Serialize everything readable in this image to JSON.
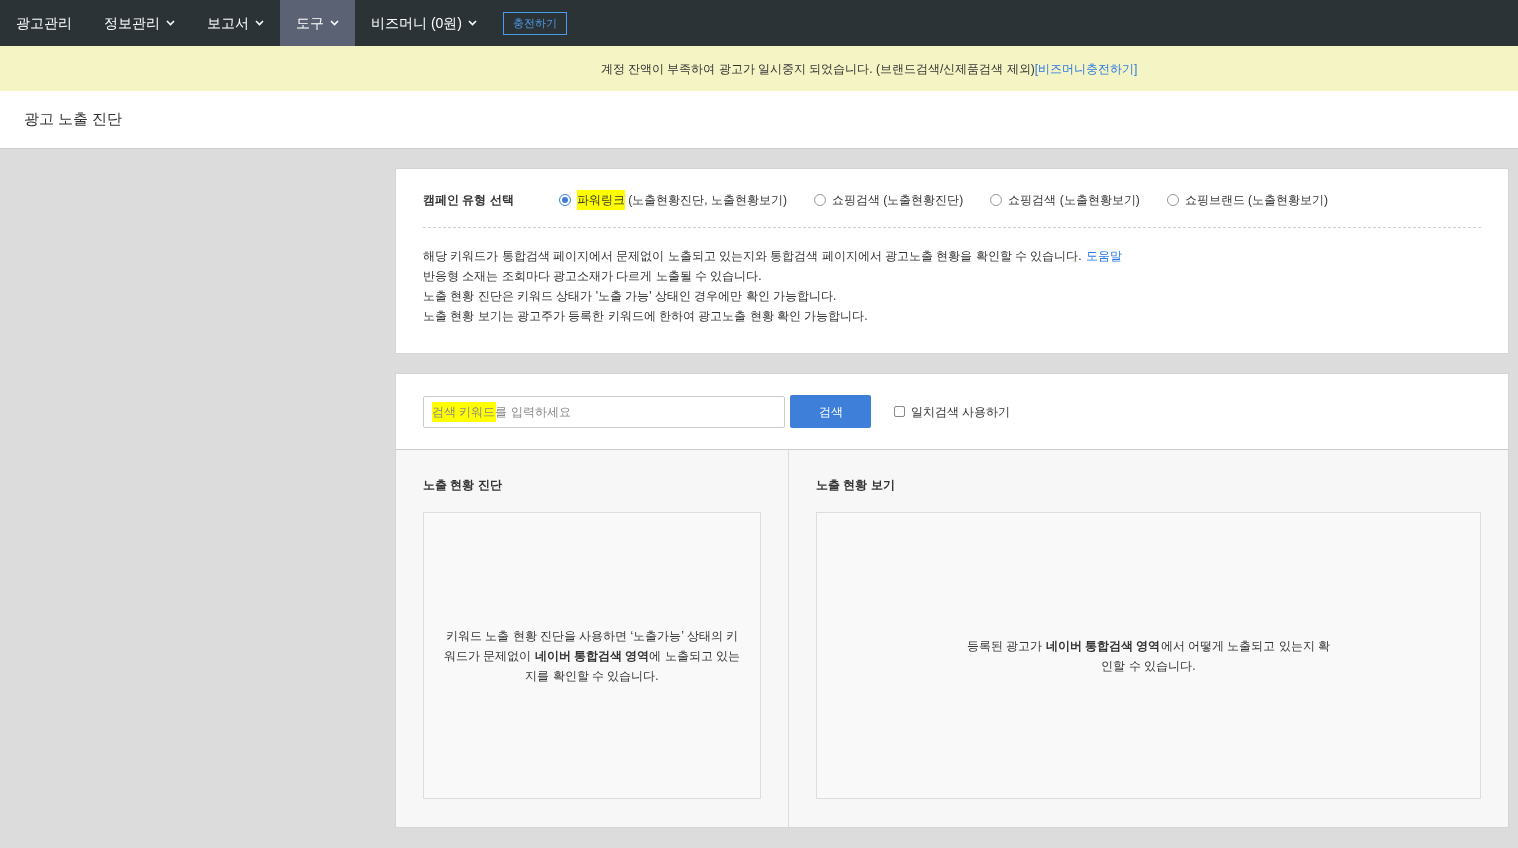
{
  "nav": {
    "items": [
      {
        "label": "광고관리",
        "dropdown": false,
        "selected": false
      },
      {
        "label": "정보관리",
        "dropdown": true,
        "selected": false
      },
      {
        "label": "보고서",
        "dropdown": true,
        "selected": false
      },
      {
        "label": "도구",
        "dropdown": true,
        "selected": true
      },
      {
        "label": "비즈머니 (0원)",
        "dropdown": true,
        "selected": false
      }
    ],
    "charge_button": "충전하기"
  },
  "notice": {
    "text": "계정 잔액이 부족하여 광고가 일시중지 되었습니다. (브랜드검색/신제품검색 제외)",
    "link": "[비즈머니충전하기]"
  },
  "page_title": "광고 노출 진단",
  "campaign_type": {
    "label": "캠페인 유형 선택",
    "options": [
      {
        "name": "파워링크",
        "detail": "(노출현황진단, 노출현황보기)",
        "selected": true,
        "highlighted": true
      },
      {
        "name": "쇼핑검색",
        "detail": "(노출현황진단)",
        "selected": false,
        "highlighted": false
      },
      {
        "name": "쇼핑검색",
        "detail": "(노출현황보기)",
        "selected": false,
        "highlighted": false
      },
      {
        "name": "쇼핑브랜드",
        "detail": "(노출현황보기)",
        "selected": false,
        "highlighted": false
      }
    ]
  },
  "info": {
    "lines": [
      "해당 키워드가 통합검색 페이지에서 문제없이 노출되고 있는지와 통합검색 페이지에서 광고노출 현황을 확인할 수 있습니다.",
      "반응형 소재는 조회마다 광고소재가 다르게 노출될 수 있습니다.",
      "노출 현황 진단은 키워드 상태가 '노출 가능' 상태인 경우에만 확인 가능합니다.",
      "노출 현황 보기는 광고주가 등록한 키워드에 한하여 광고노출 현황 확인 가능합니다."
    ],
    "help_link": "도움말"
  },
  "search": {
    "placeholder": "검색 키워드를 입력하세요",
    "button": "검색",
    "exact_match": {
      "label": "일치검색 사용하기",
      "checked": false
    }
  },
  "panels": [
    {
      "title": "노출 현황 진단",
      "text": "키워드 노출 현황 진단을 사용하면 ‘노출가능’ 상태의 키워드가 문제없이 **네이버 통합검색 영역**에 노출되고 있는지를 확인할 수 있습니다."
    },
    {
      "title": "노출 현황 보기",
      "text": "등록된 광고가 **네이버 통합검색 영역**에서 어떻게 노출되고 있는지 확인할 수 있습니다."
    }
  ]
}
